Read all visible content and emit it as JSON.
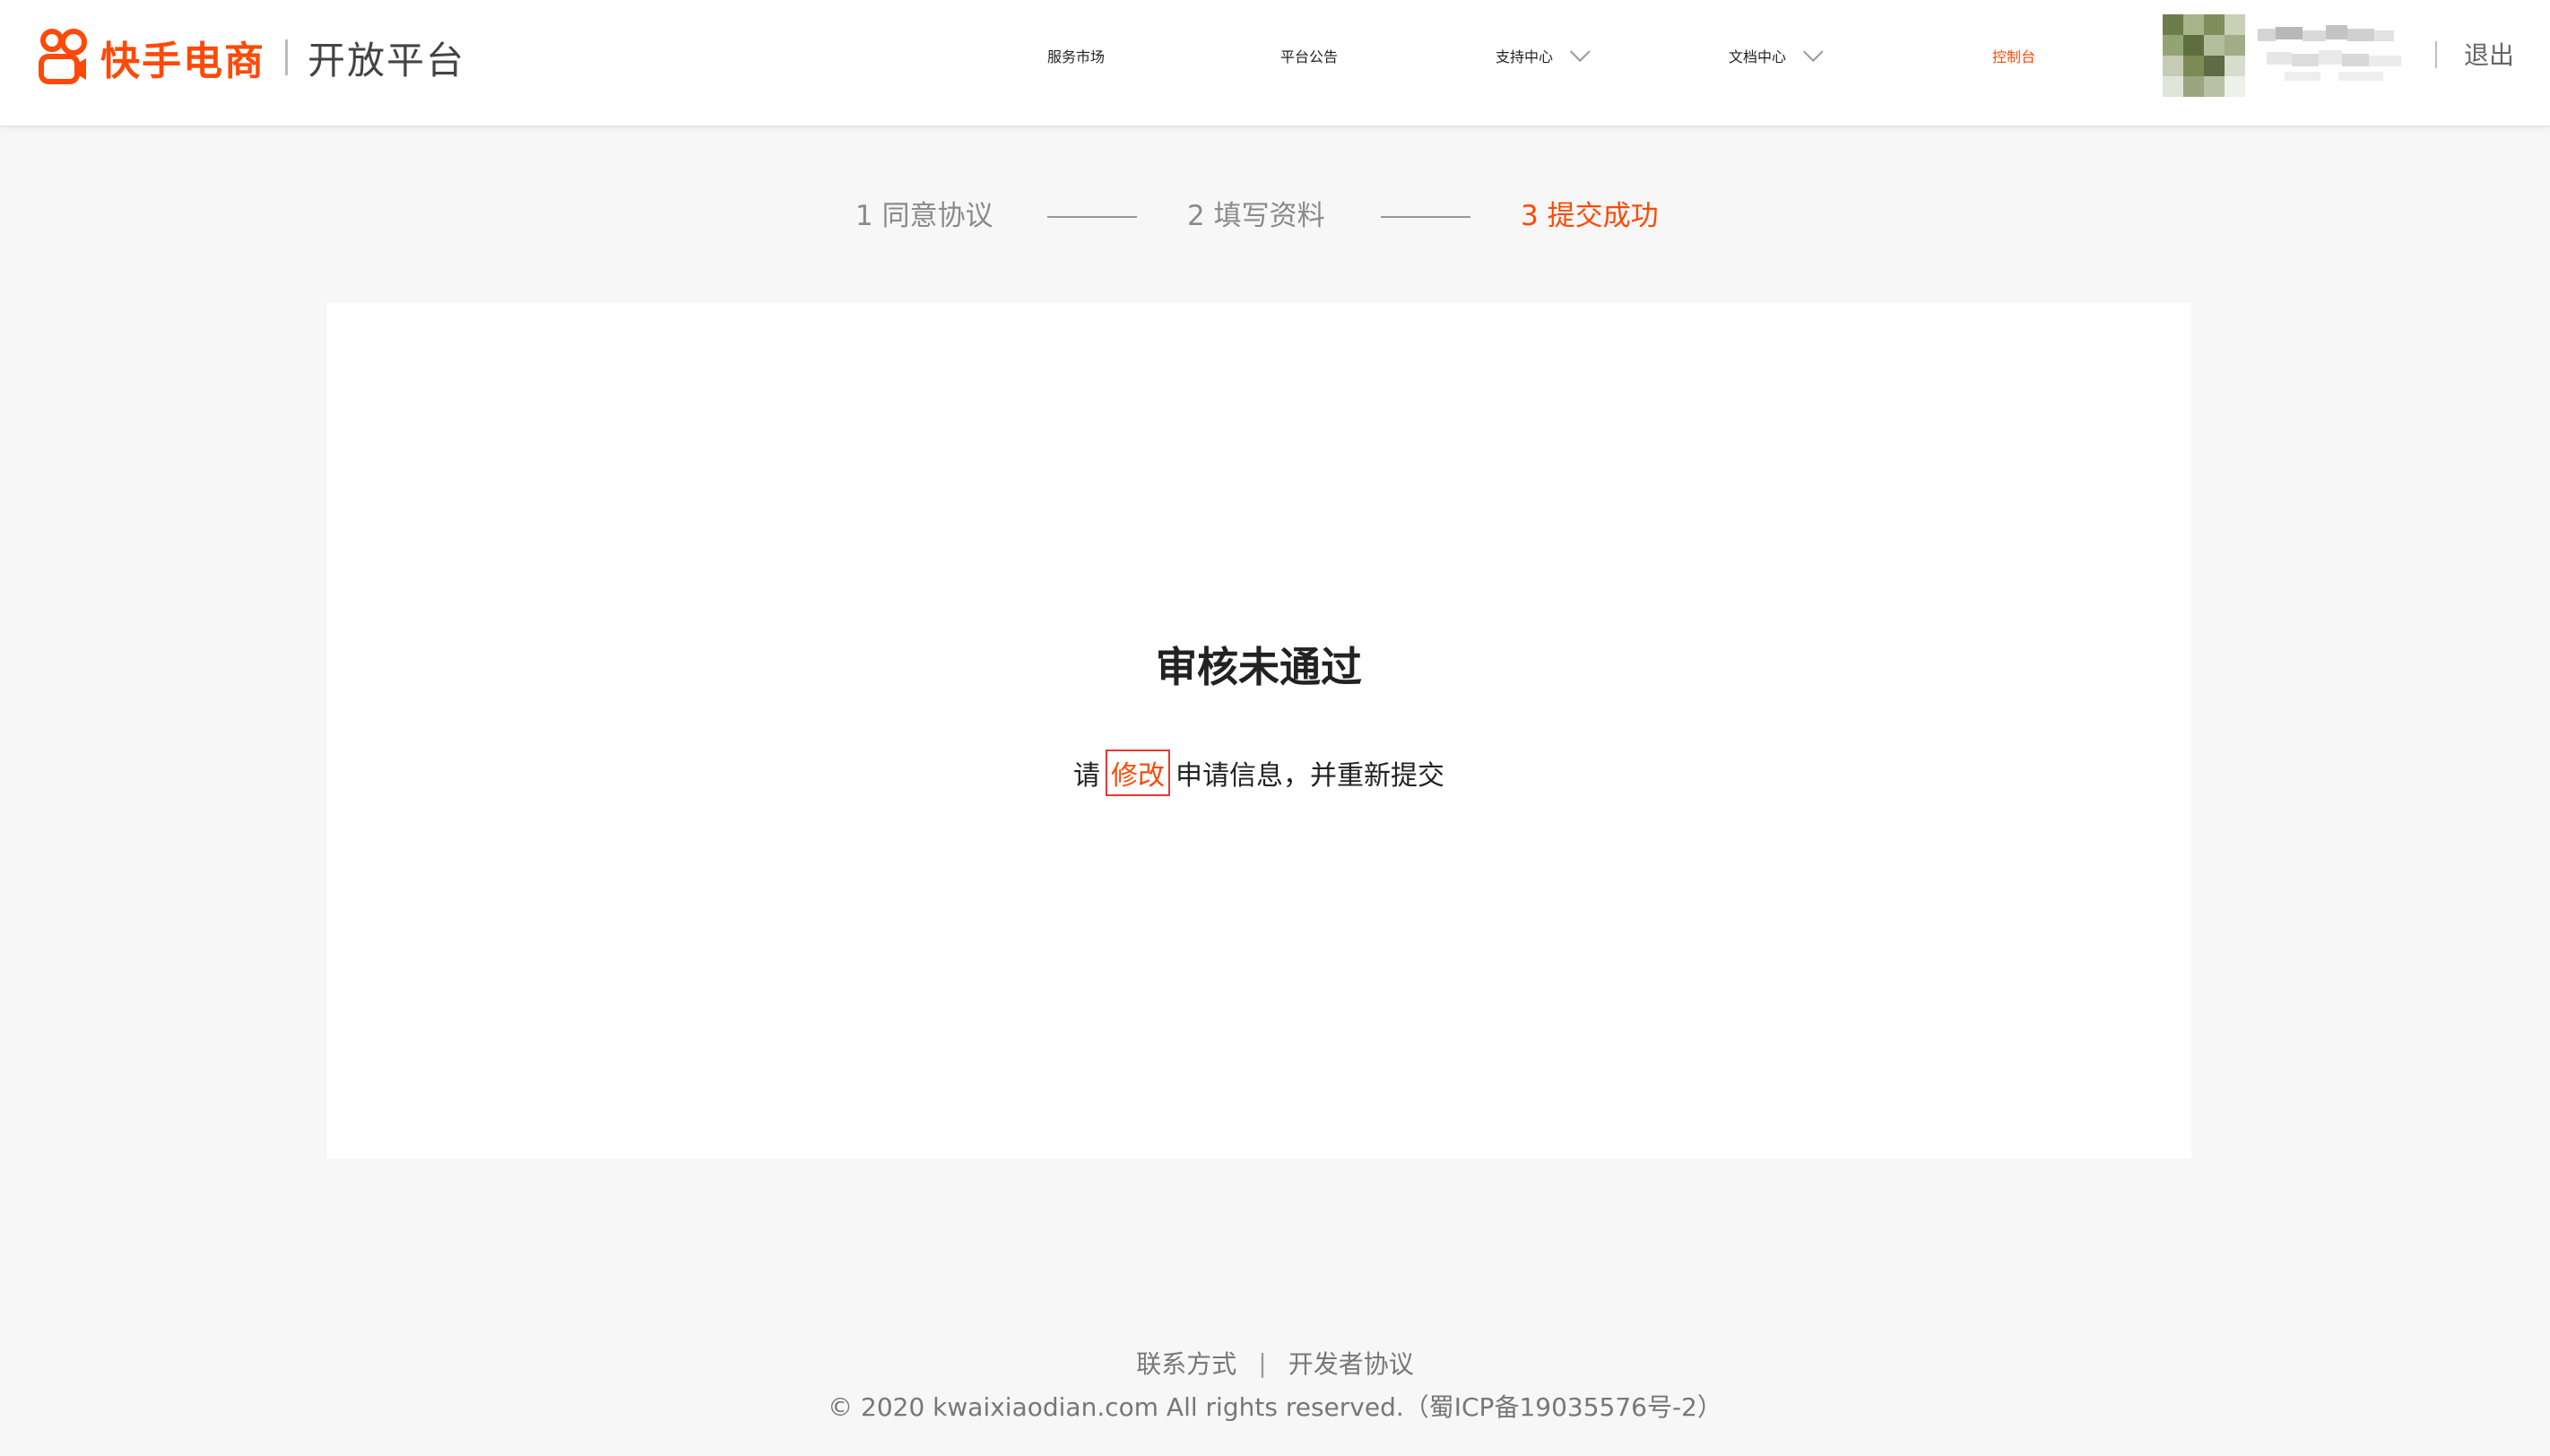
{
  "header": {
    "brand": "快手电商",
    "subtitle": "开放平台",
    "nav": [
      {
        "label": "服务市场",
        "dropdown": false,
        "active": false
      },
      {
        "label": "平台公告",
        "dropdown": false,
        "active": false
      },
      {
        "label": "支持中心",
        "dropdown": true,
        "active": false
      },
      {
        "label": "文档中心",
        "dropdown": true,
        "active": false
      },
      {
        "label": "控制台",
        "dropdown": false,
        "active": true
      }
    ],
    "logout": "退出"
  },
  "steps": [
    {
      "label": "1 同意协议",
      "state": "done"
    },
    {
      "label": "2 填写资料",
      "state": "done"
    },
    {
      "label": "3 提交成功",
      "state": "current"
    }
  ],
  "result": {
    "title": "审核未通过",
    "desc_prefix": "请",
    "modify_link": "修改",
    "desc_suffix": "申请信息，并重新提交"
  },
  "footer": {
    "contact": "联系方式",
    "developer_agreement": "开发者协议",
    "separator": "|",
    "copyright": "© 2020 kwaixiaodian.com All rights reserved.（蜀ICP备19035576号-2）"
  },
  "colors": {
    "accent": "#ff4906",
    "background": "#f7f7f7",
    "card": "#ffffff",
    "text": "#222222",
    "muted": "#8a8a8a",
    "highlight_border": "#e53935"
  }
}
